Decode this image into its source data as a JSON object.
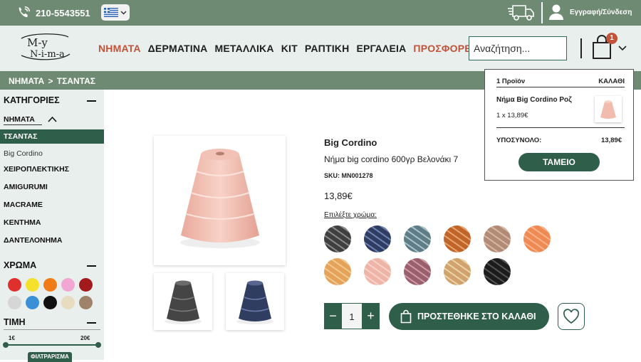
{
  "topbar": {
    "phone": "210-5543551",
    "login": "Εγγραφή/Σύνδεση"
  },
  "nav": {
    "items": [
      "ΝΗΜΑΤΑ",
      "ΔΕΡΜΑΤΙΝΑ",
      "ΜΕΤΑΛΛΙΚΑ",
      "ΚΙΤ",
      "ΡΑΠΤΙΚΗ",
      "ΕΡΓΑΛΕΙΑ",
      "ΠΡΟΣΦΟΡΕΣ"
    ],
    "search_placeholder": "Αναζήτηση...",
    "cart_count": "1",
    "accent_color": "#c0533a",
    "brand_green": "#2f5e4b"
  },
  "breadcrumb": "ΝΗΜΑΤΑ > ΤΣΑΝΤΑΣ",
  "sidebar": {
    "categories_title": "ΚΑΤΗΓΟΡΙΕΣ",
    "nimata": "ΝΗΜΑΤΑ",
    "active": "ΤΣΑΝΤΑΣ",
    "sub": "Big Cordino",
    "items": [
      "ΧΕΙΡΟΠΛΕΚΤΙΚΗΣ",
      "AMIGURUMI",
      "MACRAME",
      "ΚΕΝΤΗΜΑ",
      "ΔΑΝΤΕΛΟΝΗΜΑ"
    ],
    "color_title": "ΧΡΩΜΑ",
    "colors": [
      "#e0302d",
      "#f5e12b",
      "#f07c17",
      "#f2a7d3",
      "#a31a1c",
      "#d6d6d6",
      "#3a90d6",
      "#111111",
      "#e8dcc0",
      "#a0826a"
    ],
    "price_title": "ΤΙΜΗ",
    "price_min": "1€",
    "price_max": "20€",
    "filter_label": "ΦΙΛΤΡΑΡΙΣΜΑ"
  },
  "product": {
    "title": "Big Cordino",
    "subtitle": "Νήμα big cordino 600γρ Βελονάκι 7",
    "sku": "SKU: MN001278",
    "price": "13,89€",
    "choose_color": "Επιλέξτε χρώμα:",
    "quantity": "1",
    "add_label": "ΠΡΟΣΤΕΘΗΚΕ ΣΤΟ ΚΑΛΑΘΙ",
    "swatches": [
      {
        "base": "#3f3f3f",
        "hi": "#8a8a8a"
      },
      {
        "base": "#2f3d63",
        "hi": "#6f83b0"
      },
      {
        "base": "#5f7d86",
        "hi": "#a9c3c8"
      },
      {
        "base": "#c0652a",
        "hi": "#e9a36b"
      },
      {
        "base": "#b28a78",
        "hi": "#d7b7a0"
      },
      {
        "base": "#ef8a55",
        "hi": "#f7b389"
      },
      {
        "base": "#e5a35a",
        "hi": "#f1c98f"
      },
      {
        "base": "#efb4a8",
        "hi": "#f8d3c9"
      },
      {
        "base": "#9a5f6e",
        "hi": "#d09aa4"
      },
      {
        "base": "#d0a36e",
        "hi": "#ecd3a8"
      },
      {
        "base": "#1c1c1c",
        "hi": "#555555"
      }
    ]
  },
  "minicart": {
    "count_label": "1 Προϊόν",
    "cart_label": "ΚΑΛΑΘΙ",
    "item_name": "Νήμα Big Cordino Ροζ",
    "item_qty": "1 x 13,89€",
    "subtotal_label": "ΥΠΟΣΥΝΟΛΟ:",
    "subtotal": "13,89€",
    "checkout": "ΤΑΜΕΙΟ"
  }
}
